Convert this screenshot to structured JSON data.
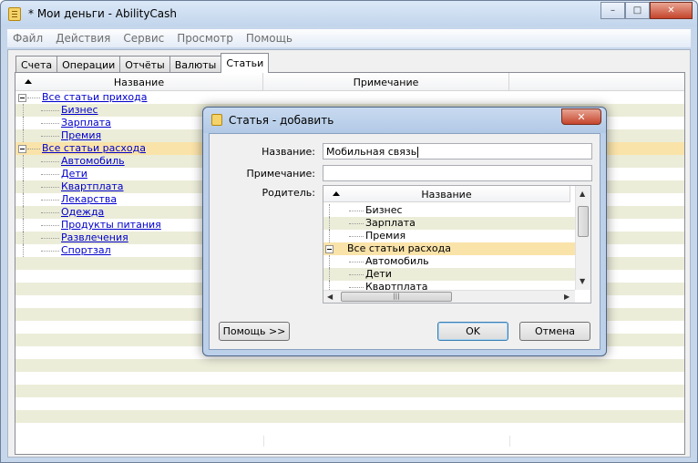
{
  "window": {
    "title": "* Мои деньги - AbilityCash",
    "minimize": "–",
    "maximize": "□",
    "close": "✕"
  },
  "menu": [
    "Файл",
    "Действия",
    "Сервис",
    "Просмотр",
    "Помощь"
  ],
  "tabs": [
    "Счета",
    "Операции",
    "Отчёты",
    "Валюты",
    "Статьи"
  ],
  "active_tab": "Статьи",
  "grid": {
    "columns": [
      "Название",
      "Примечание"
    ],
    "rows": [
      {
        "label": "Все статьи прихода",
        "level": 0,
        "expander": true
      },
      {
        "label": "Бизнес",
        "level": 1
      },
      {
        "label": "Зарплата",
        "level": 1
      },
      {
        "label": "Премия",
        "level": 1
      },
      {
        "label": "Все статьи расхода",
        "level": 0,
        "expander": true,
        "selected": true
      },
      {
        "label": "Автомобиль",
        "level": 1
      },
      {
        "label": "Дети",
        "level": 1
      },
      {
        "label": "Квартплата",
        "level": 1
      },
      {
        "label": "Лекарства",
        "level": 1
      },
      {
        "label": "Одежда",
        "level": 1
      },
      {
        "label": "Продукты питания",
        "level": 1
      },
      {
        "label": "Развлечения",
        "level": 1
      },
      {
        "label": "Спортзал",
        "level": 1
      }
    ]
  },
  "dialog": {
    "title": "Статья - добавить",
    "close": "✕",
    "name_label": "Название:",
    "name_value": "Мобильная связь",
    "note_label": "Примечание:",
    "note_value": "",
    "parent_label": "Родитель:",
    "parent_column": "Название",
    "parent_rows": [
      {
        "label": "Бизнес",
        "level": 1
      },
      {
        "label": "Зарплата",
        "level": 1
      },
      {
        "label": "Премия",
        "level": 1
      },
      {
        "label": "Все статьи расхода",
        "level": 0,
        "expander": true,
        "selected": true
      },
      {
        "label": "Автомобиль",
        "level": 1
      },
      {
        "label": "Дети",
        "level": 1
      },
      {
        "label": "Квартплата",
        "level": 1
      }
    ],
    "help_button": "Помощь >>",
    "ok_button": "OK",
    "cancel_button": "Отмена"
  },
  "colors": {
    "selected_row": "#fae3a9",
    "alt_row": "#ecedd9",
    "link": "#0000cc",
    "frame": "#c6d7ec"
  }
}
